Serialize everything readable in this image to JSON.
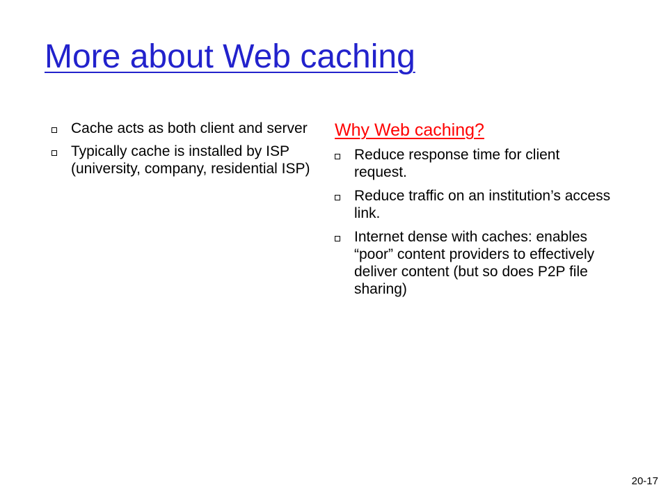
{
  "slide": {
    "title": "More about Web caching",
    "left_column": {
      "bullets": [
        "Cache acts as both client and server",
        "Typically cache is installed by ISP (university, company, residential ISP)"
      ]
    },
    "right_column": {
      "heading": "Why Web caching?",
      "bullets": [
        "Reduce response time for client request.",
        "Reduce traffic on an institution’s access link.",
        "Internet dense with caches: enables “poor” content providers to effectively deliver content (but so does P2P file sharing)"
      ]
    },
    "slide_number": "20-17"
  },
  "colors": {
    "title": "#2222cc",
    "heading": "#ff0000",
    "text": "#000000",
    "background": "#ffffff"
  },
  "icons": {
    "bullet": "square-bullet-icon"
  }
}
